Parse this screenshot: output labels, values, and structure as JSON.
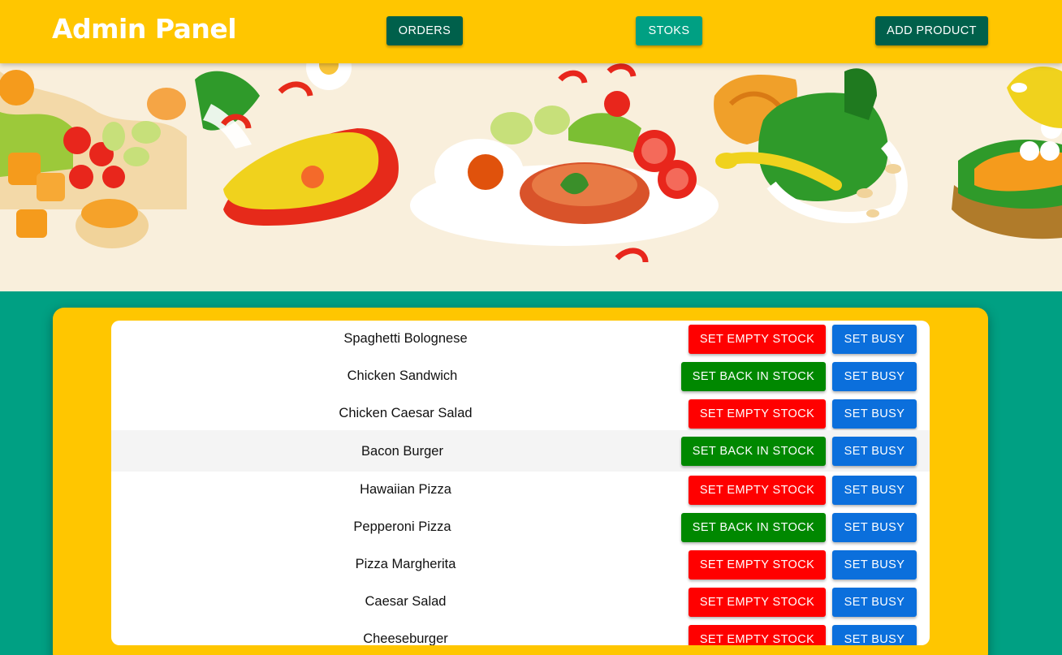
{
  "header": {
    "title": "Admin Panel",
    "nav": [
      {
        "label": "ORDERS",
        "active": false
      },
      {
        "label": "STOKS",
        "active": true
      },
      {
        "label": "ADD PRODUCT",
        "active": false
      }
    ]
  },
  "hero": {
    "image": "food-illustration-banner"
  },
  "colors": {
    "header_bg": "#ffc600",
    "page_bg": "#00a083",
    "nav_dark": "#00604b",
    "empty_stock": "#ff0000",
    "back_in_stock": "#008800",
    "busy": "#0b6fdc"
  },
  "products": [
    {
      "name": "Spaghetti Bolognese",
      "stock_action": "SET EMPTY STOCK",
      "busy_action": "SET BUSY"
    },
    {
      "name": "Chicken Sandwich",
      "stock_action": "SET BACK IN STOCK",
      "busy_action": "SET BUSY"
    },
    {
      "name": "Chicken Caesar Salad",
      "stock_action": "SET EMPTY STOCK",
      "busy_action": "SET BUSY"
    },
    {
      "name": "Bacon Burger",
      "stock_action": "SET BACK IN STOCK",
      "busy_action": "SET BUSY"
    },
    {
      "name": "Hawaiian Pizza",
      "stock_action": "SET EMPTY STOCK",
      "busy_action": "SET BUSY"
    },
    {
      "name": "Pepperoni Pizza",
      "stock_action": "SET BACK IN STOCK",
      "busy_action": "SET BUSY"
    },
    {
      "name": "Pizza Margherita",
      "stock_action": "SET EMPTY STOCK",
      "busy_action": "SET BUSY"
    },
    {
      "name": "Caesar Salad",
      "stock_action": "SET EMPTY STOCK",
      "busy_action": "SET BUSY"
    },
    {
      "name": "Cheeseburger",
      "stock_action": "SET EMPTY STOCK",
      "busy_action": "SET BUSY"
    }
  ]
}
